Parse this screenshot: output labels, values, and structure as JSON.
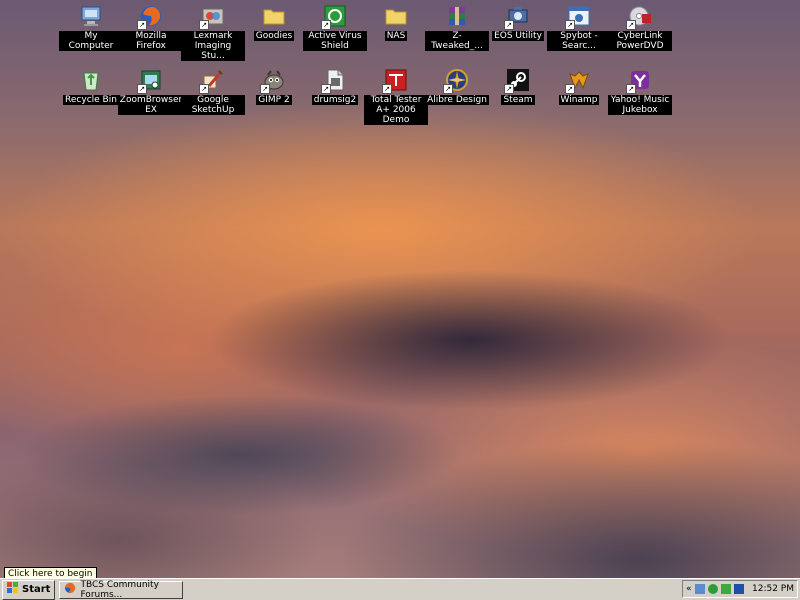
{
  "desktop": {
    "icons": [
      {
        "label": "My Computer",
        "icon": "my-computer-icon",
        "color": "#7fa6d6"
      },
      {
        "label": "Mozilla Firefox",
        "icon": "firefox-icon",
        "color": "#e66a1f"
      },
      {
        "label": "Lexmark Imaging Stu...",
        "icon": "lexmark-icon",
        "color": "#c9c3bb"
      },
      {
        "label": "Goodies",
        "icon": "folder-icon",
        "color": "#f2d36b"
      },
      {
        "label": "Active Virus Shield",
        "icon": "antivirus-shield-icon",
        "color": "#2a9d3a"
      },
      {
        "label": "NAS",
        "icon": "folder-icon",
        "color": "#f2d36b"
      },
      {
        "label": "Z-Tweaked_...",
        "icon": "winrar-icon",
        "color": "#7a3c9a"
      },
      {
        "label": "EOS Utility",
        "icon": "eos-utility-icon",
        "color": "#4a6ea8"
      },
      {
        "label": "Spybot - Searc...",
        "icon": "spybot-icon",
        "color": "#3b6fb6"
      },
      {
        "label": "CyberLink PowerDVD",
        "icon": "powerdvd-icon",
        "color": "#c3202a"
      },
      {
        "label": "Recycle Bin",
        "icon": "recycle-bin-icon",
        "color": "#5aa05a"
      },
      {
        "label": "ZoomBrowser EX",
        "icon": "zoombrowser-icon",
        "color": "#2e7d4f"
      },
      {
        "label": "Google SketchUp",
        "icon": "sketchup-icon",
        "color": "#c0392b"
      },
      {
        "label": "GIMP 2",
        "icon": "gimp-icon",
        "color": "#777777"
      },
      {
        "label": "drumsig2",
        "icon": "document-icon",
        "color": "#dcdcdc"
      },
      {
        "label": "Total Tester A+ 2006 Demo",
        "icon": "total-tester-icon",
        "color": "#cc2020"
      },
      {
        "label": "Alibre Design",
        "icon": "alibre-icon",
        "color": "#d6a12a"
      },
      {
        "label": "Steam",
        "icon": "steam-icon",
        "color": "#222222"
      },
      {
        "label": "Winamp",
        "icon": "winamp-icon",
        "color": "#e59a1c"
      },
      {
        "label": "Yahoo! Music Jukebox",
        "icon": "yahoo-music-icon",
        "color": "#7b2e9c"
      }
    ]
  },
  "tooltip": {
    "text": "Click here to begin"
  },
  "taskbar": {
    "start_label": "Start",
    "tasks": [
      {
        "label": "TBCS Community Forums..."
      }
    ],
    "tray": {
      "chevron": "«",
      "clock": "12:52 PM"
    }
  }
}
